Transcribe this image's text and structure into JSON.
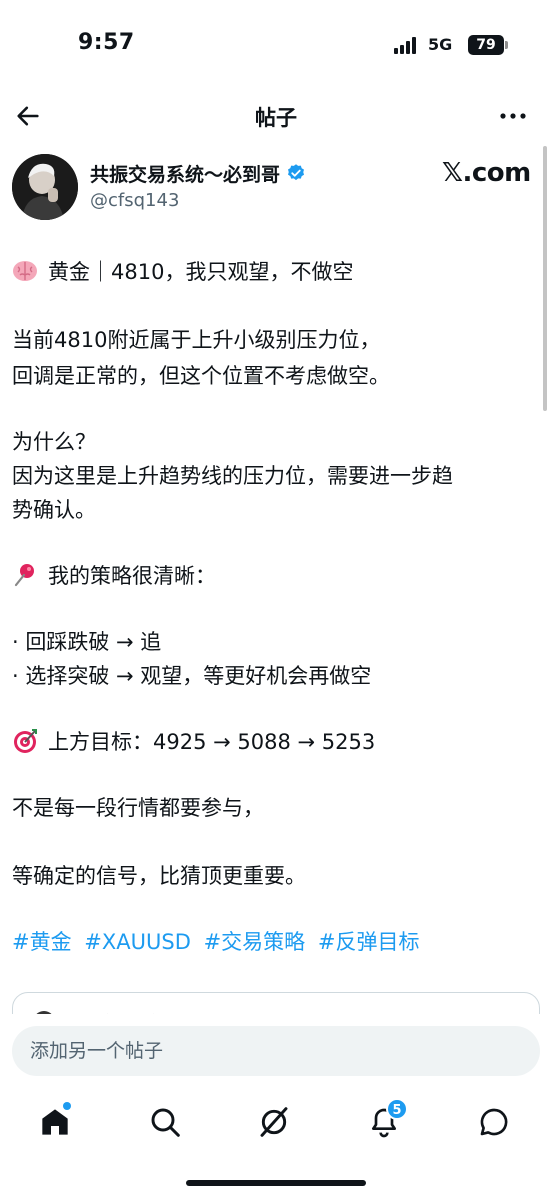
{
  "status_bar": {
    "time": "9:57",
    "network": "5G",
    "battery": "79"
  },
  "header": {
    "title": "帖子",
    "back_icon": "arrow-left-icon",
    "more_icon": "more-horizontal-icon"
  },
  "author": {
    "name": "共振交易系统～必到哥",
    "handle": "@cfsq143",
    "verified": true,
    "site": "𝕏.com"
  },
  "post": {
    "lines": [
      {
        "emoji": "brain-emoji",
        "text": "黄金｜4810，我只观望，不做空"
      },
      {
        "text": "当前4810附近属于上升小级别压力位，"
      },
      {
        "text": "回调是正常的，但这个位置不考虑做空。"
      },
      {
        "text": "为什么？"
      },
      {
        "text": "因为这里是上升趋势线的压力位，需要进一步趋"
      },
      {
        "text": "势确认。"
      },
      {
        "emoji": "pushpin-emoji",
        "text": "我的策略很清晰："
      },
      {
        "text": "· 回踩跌破 → 追"
      },
      {
        "text": "· 选择突破 → 观望，等更好机会再做空"
      },
      {
        "emoji": "target-emoji",
        "text": "上方目标：4925 → 5088 → 5253"
      },
      {
        "text": "不是每一段行情都要参与，"
      },
      {
        "text": "等确定的信号，比猜顶更重要。"
      }
    ],
    "hashtags": [
      "#黄金",
      "#XAUUSD",
      "#交易策略",
      "#反弹目标"
    ]
  },
  "quote": {
    "author_partial": "共振交易系统～必到哥"
  },
  "reply": {
    "placeholder": "添加另一个帖子"
  },
  "nav": {
    "items": [
      "home-icon",
      "search-icon",
      "grok-icon",
      "notifications-icon",
      "messages-icon"
    ],
    "notification_count": "5"
  },
  "colors": {
    "accent": "#1d9bf0",
    "text": "#0f1419",
    "muted": "#536471"
  }
}
